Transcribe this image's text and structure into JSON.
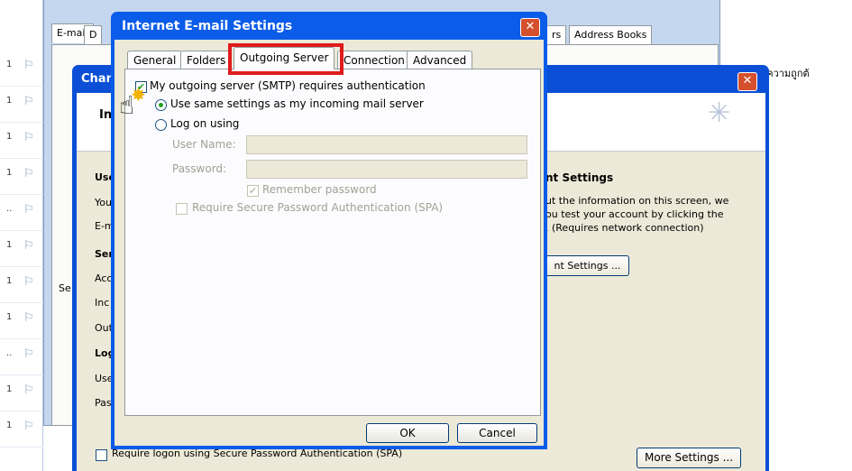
{
  "message_list": {
    "rows": [
      {
        "num": "1",
        "flag": "⚐"
      },
      {
        "num": "1",
        "flag": "⚐"
      },
      {
        "num": "1",
        "flag": "⚐"
      },
      {
        "num": "1",
        "flag": "⚐"
      },
      {
        "num": "..",
        "flag": "⚐"
      },
      {
        "num": "1",
        "flag": "⚐"
      },
      {
        "num": "1",
        "flag": "⚐"
      },
      {
        "num": "1",
        "flag": "⚐"
      },
      {
        "num": "..",
        "flag": "⚐"
      },
      {
        "num": "1",
        "flag": "⚐"
      },
      {
        "num": "1",
        "flag": "⚐"
      }
    ]
  },
  "account_settings": {
    "tabs": [
      "E-mail",
      "D",
      "rs",
      "Address Books"
    ],
    "left_label": "Se",
    "right_thai": "ถ้าข้อมูลมีความถูกต้"
  },
  "change_account": {
    "title": "Chan",
    "header_text": "In",
    "left_labels": [
      "Use",
      "You",
      "E-m",
      "Ser",
      "Acc",
      "Inc",
      "Out",
      "Log",
      "Use",
      "Pas"
    ],
    "test_heading": "nt Settings",
    "test_text_1": "ut the information on this screen, we",
    "test_text_2": "ou test your account by clicking the",
    "test_text_3": ". (Requires network connection)",
    "test_button": "nt Settings ...",
    "require_spa": "Require logon using Secure Password Authentication (SPA)",
    "more_settings": "More Settings ..."
  },
  "dialog": {
    "title": "Internet E-mail Settings",
    "tabs": [
      "General",
      "Folders",
      "Outgoing Server",
      "Connection",
      "Advanced"
    ],
    "active_tab": "Outgoing Server",
    "smtp_auth": {
      "label": "My outgoing server (SMTP) requires authentication",
      "checked": true
    },
    "use_same": {
      "label": "Use same settings as my incoming mail server",
      "selected": true
    },
    "log_on_using": {
      "label": "Log on using",
      "selected": false
    },
    "username": {
      "label": "User Name:",
      "value": ""
    },
    "password": {
      "label": "Password:",
      "value": ""
    },
    "remember": {
      "label": "Remember password",
      "checked": true
    },
    "require_spa": {
      "label": "Require Secure Password Authentication (SPA)",
      "checked": false
    },
    "ok": "OK",
    "cancel": "Cancel"
  }
}
